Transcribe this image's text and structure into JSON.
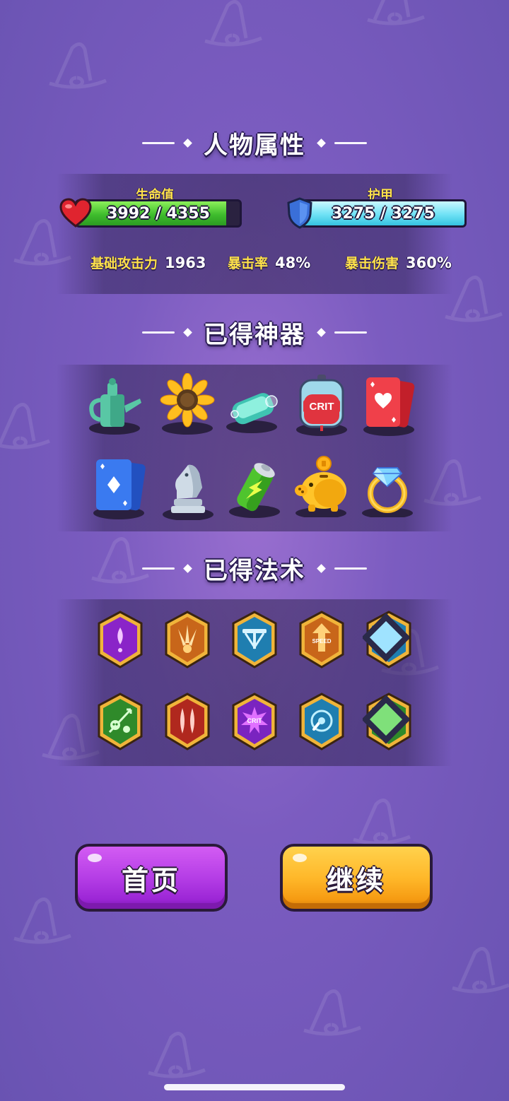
{
  "attributes": {
    "title": "人物属性",
    "hp": {
      "label": "生命值",
      "current": 3992,
      "max": 4355,
      "text": "3992 / 4355",
      "fill_fraction": 0.917,
      "color": "#3fbd2d"
    },
    "armor": {
      "label": "护甲",
      "current": 3275,
      "max": 3275,
      "text": "3275 / 3275",
      "fill_fraction": 1.0,
      "color": "#6fe2f5"
    },
    "stats": [
      {
        "label": "基础攻击力",
        "value": "1963"
      },
      {
        "label": "暴击率",
        "value": "48%"
      },
      {
        "label": "暴击伤害",
        "value": "360%"
      }
    ]
  },
  "artifacts": {
    "title": "已得神器",
    "items": [
      {
        "icon": "watering-can-icon"
      },
      {
        "icon": "sunflower-icon"
      },
      {
        "icon": "soap-bar-icon"
      },
      {
        "icon": "crit-potion-bag-icon",
        "text": "CRIT"
      },
      {
        "icon": "heart-card-icon"
      },
      {
        "icon": "diamond-card-icon"
      },
      {
        "icon": "chess-knight-icon"
      },
      {
        "icon": "battery-icon"
      },
      {
        "icon": "piggy-bank-icon"
      },
      {
        "icon": "diamond-ring-icon"
      }
    ]
  },
  "spells": {
    "title": "已得法术",
    "items": [
      {
        "icon": "purple-bolt-spell-icon"
      },
      {
        "icon": "triple-shot-spell-icon"
      },
      {
        "icon": "crossbow-spell-icon"
      },
      {
        "icon": "speed-up-spell-icon",
        "text": "SPEED"
      },
      {
        "icon": "ice-shard-spell-icon",
        "upgraded": true
      },
      {
        "icon": "poison-skull-spell-icon"
      },
      {
        "icon": "double-claw-spell-icon"
      },
      {
        "icon": "crit-burst-spell-icon",
        "text": "CRIT"
      },
      {
        "icon": "orbit-spell-icon"
      },
      {
        "icon": "sheep-spell-icon",
        "upgraded": true
      }
    ]
  },
  "buttons": {
    "home": "首页",
    "continue": "继续"
  },
  "colors": {
    "background": "#7b5cc0",
    "stat_label": "#ffe24a",
    "home_button": "#b53ee6",
    "continue_button": "#ffb82a"
  }
}
